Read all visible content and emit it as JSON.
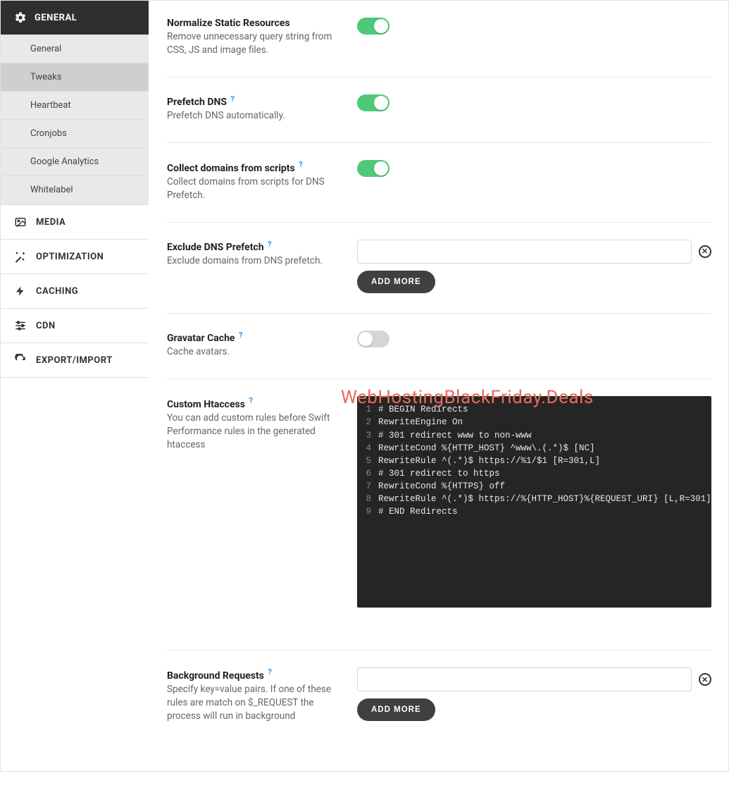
{
  "sidebar": {
    "sections": [
      {
        "id": "general",
        "label": "GENERAL",
        "icon": "gear",
        "active": true,
        "sub": [
          {
            "id": "general-sub",
            "label": "General",
            "active": false
          },
          {
            "id": "tweaks",
            "label": "Tweaks",
            "active": true
          },
          {
            "id": "heartbeat",
            "label": "Heartbeat",
            "active": false
          },
          {
            "id": "cronjobs",
            "label": "Cronjobs",
            "active": false
          },
          {
            "id": "google-analytics",
            "label": "Google Analytics",
            "active": false
          },
          {
            "id": "whitelabel",
            "label": "Whitelabel",
            "active": false
          }
        ]
      },
      {
        "id": "media",
        "label": "MEDIA",
        "icon": "image"
      },
      {
        "id": "optimization",
        "label": "OPTIMIZATION",
        "icon": "wand"
      },
      {
        "id": "caching",
        "label": "CACHING",
        "icon": "bolt"
      },
      {
        "id": "cdn",
        "label": "CDN",
        "icon": "sliders"
      },
      {
        "id": "export-import",
        "label": "EXPORT/IMPORT",
        "icon": "refresh"
      }
    ]
  },
  "settings": {
    "normalize": {
      "title": "Normalize Static Resources",
      "desc": "Remove unnecessary query string from CSS, JS and image files.",
      "on": true
    },
    "prefetch": {
      "title": "Prefetch DNS",
      "desc": "Prefetch DNS automatically.",
      "on": true,
      "help": true
    },
    "collect": {
      "title": "Collect domains from scripts",
      "desc": "Collect domains from scripts for DNS Prefetch.",
      "on": true,
      "help": true
    },
    "exclude": {
      "title": "Exclude DNS Prefetch",
      "desc": "Exclude domains from DNS prefetch.",
      "help": true,
      "value": "",
      "add_label": "ADD MORE"
    },
    "gravatar": {
      "title": "Gravatar Cache",
      "desc": "Cache avatars.",
      "on": false,
      "help": true
    },
    "htaccess": {
      "title": "Custom Htaccess",
      "desc": "You can add custom rules before Swift Performance rules in the generated htaccess",
      "help": true,
      "code": [
        "# BEGIN Redirects",
        "RewriteEngine On",
        "# 301 redirect www to non-www",
        "RewriteCond %{HTTP_HOST} ^www\\.(.*)$ [NC]",
        "RewriteRule ^(.*)$ https://%1/$1 [R=301,L]",
        "# 301 redirect to https",
        "RewriteCond %{HTTPS} off",
        "RewriteRule ^(.*)$ https://%{HTTP_HOST}%{REQUEST_URI} [L,R=301]",
        "# END Redirects"
      ]
    },
    "background": {
      "title": "Background Requests",
      "desc": "Specify key=value pairs. If one of these rules are match on $_REQUEST the process will run in background",
      "help": true,
      "value": "",
      "add_label": "ADD MORE"
    }
  },
  "watermark": "WebHostingBlackFriday.Deals"
}
